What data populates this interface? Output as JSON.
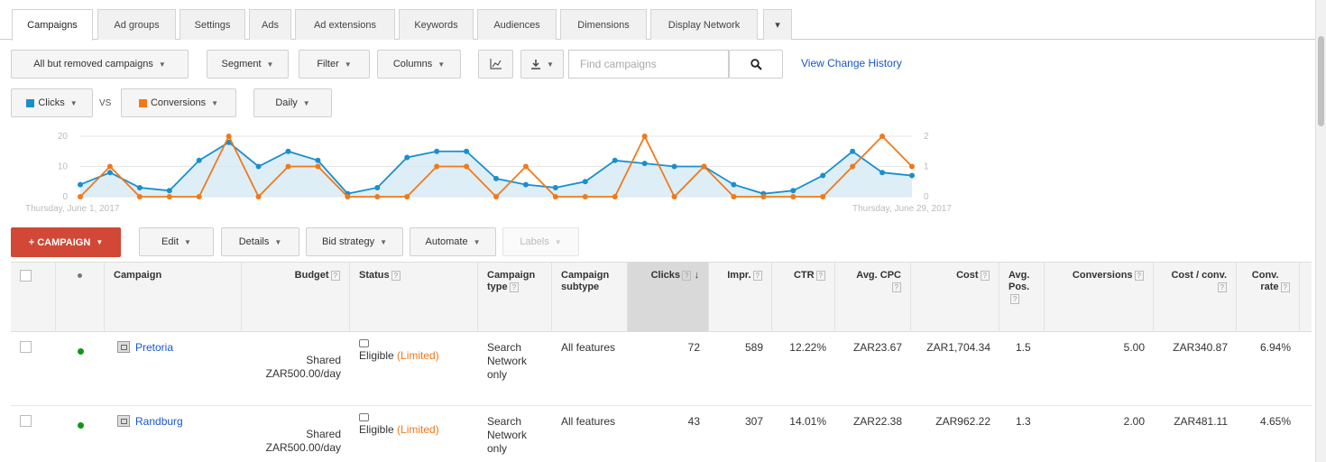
{
  "tabs": [
    "Campaigns",
    "Ad groups",
    "Settings",
    "Ads",
    "Ad extensions",
    "Keywords",
    "Audiences",
    "Dimensions",
    "Display Network"
  ],
  "tabs_more": "▾",
  "toolbar": {
    "filter_view": "All but removed campaigns",
    "segment": "Segment",
    "filter": "Filter",
    "columns": "Columns",
    "chart_icon": "chart-icon",
    "download_icon": "download-icon",
    "search_placeholder": "Find campaigns",
    "history_link": "View Change History"
  },
  "metrics": {
    "metric1": "Clicks",
    "vs": "VS",
    "metric2": "Conversions",
    "period": "Daily",
    "color1": "#1a8fcc",
    "color2": "#f0791b"
  },
  "chart_data": {
    "type": "line",
    "x_start_label": "Thursday, June 1, 2017",
    "x_end_label": "Thursday, June 29, 2017",
    "left_axis": {
      "ticks": [
        "20",
        "10",
        "0"
      ],
      "ylim": [
        0,
        20
      ]
    },
    "right_axis": {
      "ticks": [
        "2",
        "1",
        "0"
      ],
      "ylim": [
        0,
        2
      ]
    },
    "series": [
      {
        "name": "Clicks",
        "axis": "left",
        "color": "#1a8fcc",
        "values": [
          4,
          8,
          3,
          2,
          12,
          18,
          10,
          15,
          12,
          1,
          3,
          13,
          15,
          15,
          6,
          4,
          3,
          5,
          12,
          11,
          10,
          10,
          4,
          1,
          2,
          7,
          15,
          8,
          7
        ]
      },
      {
        "name": "Conversions",
        "axis": "right",
        "color": "#f0791b",
        "values": [
          0,
          1,
          0,
          0,
          0,
          2,
          0,
          1,
          1,
          0,
          0,
          0,
          1,
          1,
          0,
          1,
          0,
          0,
          0,
          2,
          0,
          1,
          0,
          0,
          0,
          0,
          1,
          2,
          1
        ]
      }
    ]
  },
  "actions": {
    "add_campaign": "+ CAMPAIGN",
    "edit": "Edit",
    "details": "Details",
    "bid_strategy": "Bid strategy",
    "automate": "Automate",
    "labels": "Labels"
  },
  "table": {
    "help": "?",
    "headers": {
      "campaign": "Campaign",
      "budget": "Budget",
      "status": "Status",
      "type": "Campaign type",
      "subtype": "Campaign subtype",
      "clicks": "Clicks",
      "sort_arrow": "↓",
      "impr": "Impr.",
      "ctr": "CTR",
      "avg_cpc": "Avg. CPC",
      "cost": "Cost",
      "avg_pos": "Avg. Pos.",
      "conversions": "Conversions",
      "cost_conv": "Cost / conv.",
      "conv_rate": "Conv. rate"
    },
    "rows": [
      {
        "campaign": "Pretoria",
        "budget1": "Shared",
        "budget2": "ZAR500.00/day",
        "status": "Eligible",
        "status_note": "(Limited)",
        "type": "Search Network only",
        "subtype": "All features",
        "clicks": "72",
        "impr": "589",
        "ctr": "12.22%",
        "avg_cpc": "ZAR23.67",
        "cost": "ZAR1,704.34",
        "avg_pos": "1.5",
        "conversions": "5.00",
        "cost_conv": "ZAR340.87",
        "conv_rate": "6.94%"
      },
      {
        "campaign": "Randburg",
        "budget1": "Shared",
        "budget2": "ZAR500.00/day",
        "status": "Eligible",
        "status_note": "(Limited)",
        "type": "Search Network only",
        "subtype": "All features",
        "clicks": "43",
        "impr": "307",
        "ctr": "14.01%",
        "avg_cpc": "ZAR22.38",
        "cost": "ZAR962.22",
        "avg_pos": "1.3",
        "conversions": "2.00",
        "cost_conv": "ZAR481.11",
        "conv_rate": "4.65%"
      }
    ]
  }
}
